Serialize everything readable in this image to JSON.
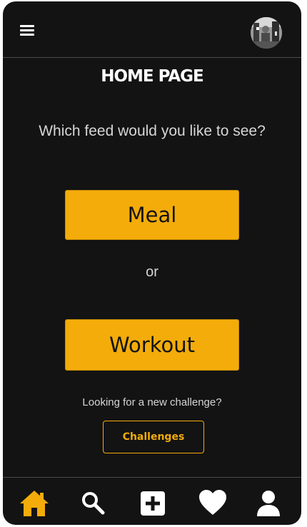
{
  "header": {
    "menu_icon": "hamburger-menu-icon",
    "avatar": "user-avatar"
  },
  "main": {
    "title": "HOME PAGE",
    "question": "Which feed would you like to see?",
    "meal_label": "Meal",
    "or_label": "or",
    "workout_label": "Workout",
    "challenge_prompt": "Looking for a new challenge?",
    "challenges_label": "Challenges"
  },
  "bottom_nav": {
    "items": [
      {
        "icon": "home-icon",
        "active": true
      },
      {
        "icon": "search-icon",
        "active": false
      },
      {
        "icon": "add-post-icon",
        "active": false
      },
      {
        "icon": "heart-icon",
        "active": false
      },
      {
        "icon": "profile-icon",
        "active": false
      }
    ]
  },
  "colors": {
    "background": "#131313",
    "accent": "#f3ac0a",
    "text_light": "#d6d6d6",
    "white": "#ffffff"
  }
}
